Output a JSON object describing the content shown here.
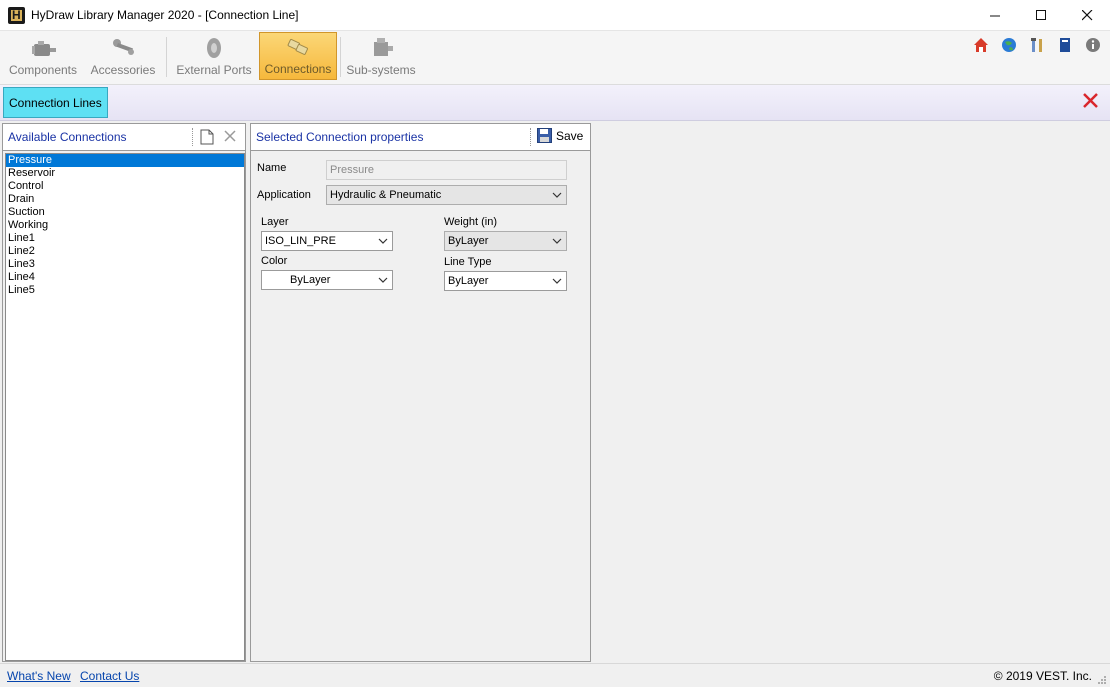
{
  "window": {
    "title": "HyDraw Library Manager 2020 - [Connection Line]",
    "controls": {
      "minimize": "—",
      "maximize": "☐",
      "close": "✕"
    }
  },
  "ribbon": {
    "tabs": [
      {
        "label": "Components",
        "icon": "motor-icon",
        "active": false
      },
      {
        "label": "Accessories",
        "icon": "wrench-icon",
        "active": false
      },
      {
        "label": "External Ports",
        "icon": "port-icon",
        "active": false
      },
      {
        "label": "Connections",
        "icon": "connection-fittings-icon",
        "active": true
      },
      {
        "label": "Sub-systems",
        "icon": "subsystem-icon",
        "active": false
      }
    ],
    "top_icons": [
      "home-icon",
      "globe-icon",
      "tools-icon",
      "book-icon",
      "info-icon"
    ]
  },
  "subbar": {
    "active_tab": "Connection Lines"
  },
  "left_panel": {
    "title": "Available Connections",
    "items": [
      "Pressure",
      "Reservoir",
      "Control",
      "Drain",
      "Suction",
      "Working",
      "Line1",
      "Line2",
      "Line3",
      "Line4",
      "Line5"
    ],
    "selected_index": 0
  },
  "properties": {
    "title": "Selected Connection properties",
    "save_label": "Save",
    "name_label": "Name",
    "name_value": "Pressure",
    "application_label": "Application",
    "application_value": "Hydraulic & Pneumatic",
    "layer_label": "Layer",
    "layer_value": "ISO_LIN_PRE",
    "weight_label": "Weight (in)",
    "weight_value": "ByLayer",
    "color_label": "Color",
    "color_value": "ByLayer",
    "linetype_label": "Line Type",
    "linetype_value": "ByLayer"
  },
  "status": {
    "whats_new": "What's New",
    "contact_us": "Contact Us",
    "copyright": "© 2019 VEST. Inc."
  },
  "colors": {
    "active_tab": "#f6b83c",
    "subtab": "#5ee0f3",
    "selection": "#0078d7",
    "panel_title": "#1a33a5",
    "close_red": "#d9262c"
  }
}
